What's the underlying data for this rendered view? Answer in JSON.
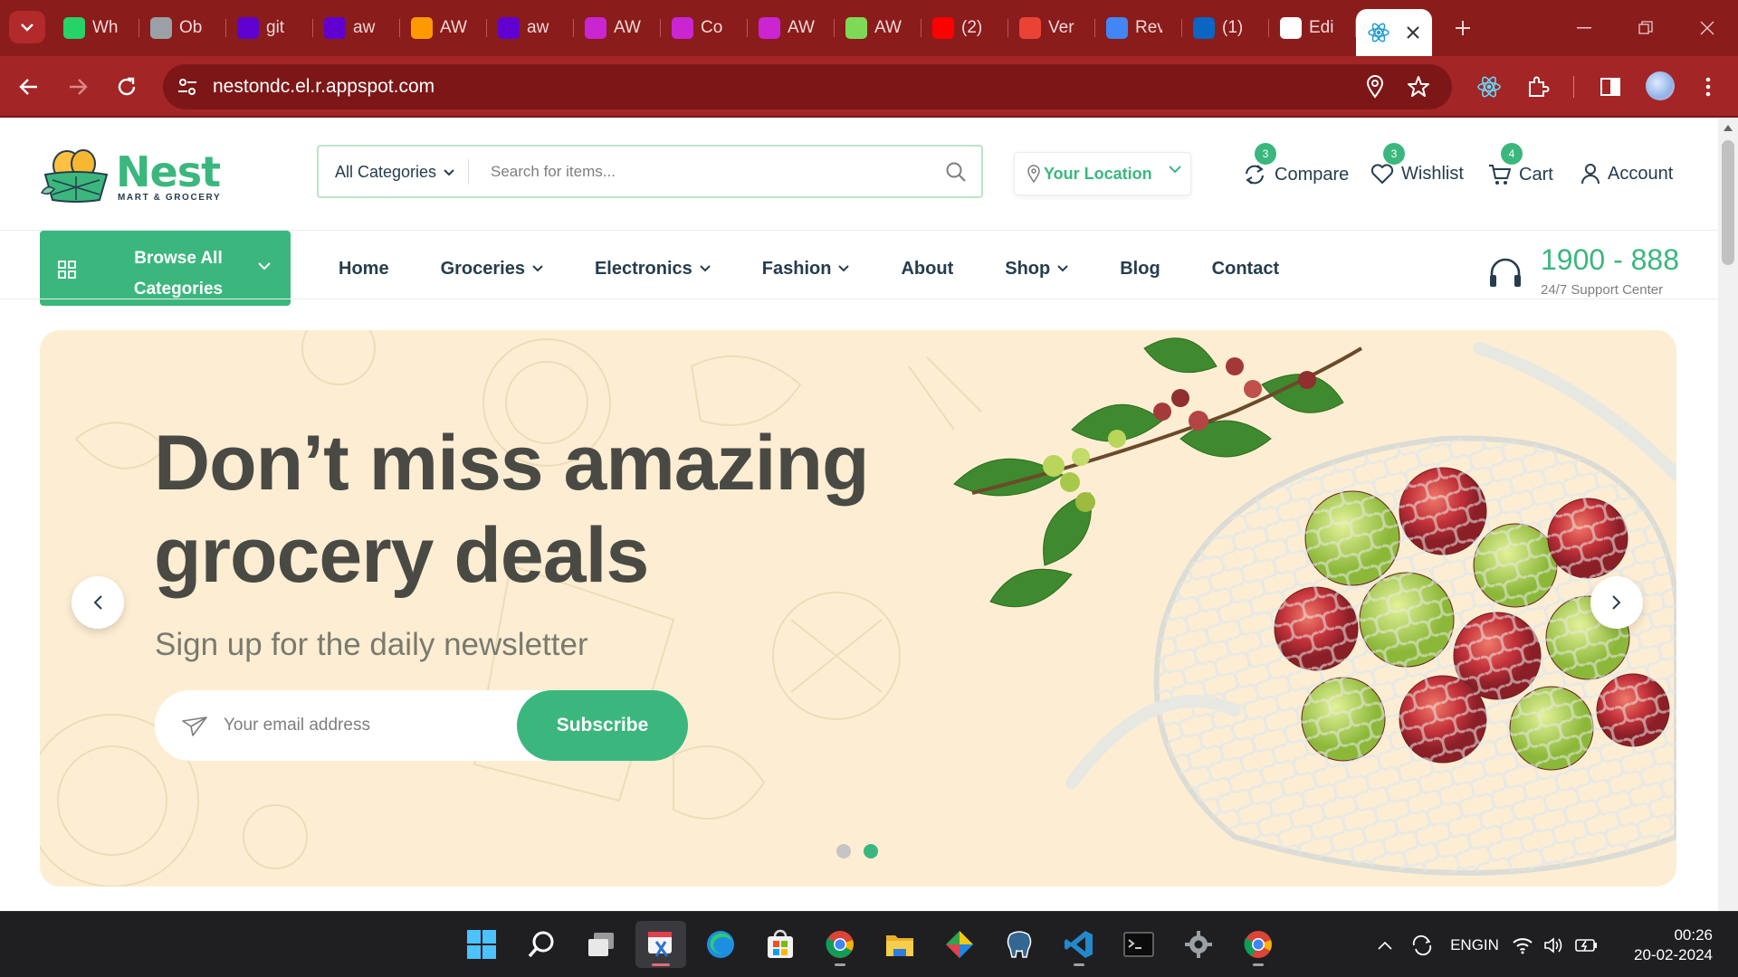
{
  "browser": {
    "tabs": [
      {
        "label": "Wh",
        "icon": "whatsapp-icon",
        "color": "#25d366"
      },
      {
        "label": "Ob",
        "icon": "globe-icon",
        "color": "#9aa0a6"
      },
      {
        "label": "git",
        "icon": "yahoo-icon",
        "color": "#6001d2"
      },
      {
        "label": "aw",
        "icon": "yahoo-icon",
        "color": "#6001d2"
      },
      {
        "label": "AW",
        "icon": "aws-box-icon",
        "color": "#ff9900"
      },
      {
        "label": "aw",
        "icon": "yahoo-icon",
        "color": "#6001d2"
      },
      {
        "label": "AW",
        "icon": "aws-cube-icon",
        "color": "#c925d1"
      },
      {
        "label": "Co",
        "icon": "aws-cube-icon",
        "color": "#c925d1"
      },
      {
        "label": "AW",
        "icon": "aws-cube-icon",
        "color": "#c925d1"
      },
      {
        "label": "AW",
        "icon": "pulse-icon",
        "color": "#7ed957"
      },
      {
        "label": "(2)",
        "icon": "youtube-icon",
        "color": "#ff0000"
      },
      {
        "label": "Ver",
        "icon": "gmail-icon",
        "color": "#ea4335"
      },
      {
        "label": "Rev",
        "icon": "google-icon",
        "color": "#4285f4"
      },
      {
        "label": "(1)",
        "icon": "linkedin-icon",
        "color": "#0a66c2"
      },
      {
        "label": "Edi",
        "icon": "github-icon",
        "color": "#ffffff"
      }
    ],
    "active_tab_icon": "react-icon",
    "url": "nestondc.el.r.appspot.com"
  },
  "header": {
    "logo_name": "Nest",
    "logo_tagline": "MART & GROCERY",
    "category_select": "All Categories",
    "search_placeholder": "Search for items...",
    "location_label": "Your Location",
    "actions": [
      {
        "label": "Compare",
        "badge": "3"
      },
      {
        "label": "Wishlist",
        "badge": "3"
      },
      {
        "label": "Cart",
        "badge": "4"
      },
      {
        "label": "Account"
      }
    ]
  },
  "nav": {
    "browse_label": "Browse All Categories",
    "items": [
      {
        "label": "Home",
        "dropdown": false
      },
      {
        "label": "Groceries",
        "dropdown": true
      },
      {
        "label": "Electronics",
        "dropdown": true
      },
      {
        "label": "Fashion",
        "dropdown": true
      },
      {
        "label": "About",
        "dropdown": false
      },
      {
        "label": "Shop",
        "dropdown": true
      },
      {
        "label": "Blog",
        "dropdown": false
      },
      {
        "label": "Contact",
        "dropdown": false
      }
    ],
    "support_phone": "1900 - 888",
    "support_text": "24/7 Support Center"
  },
  "hero": {
    "title": "Don’t miss amazing grocery deals",
    "subtitle": "Sign up for the daily newsletter",
    "email_placeholder": "Your email address",
    "subscribe_label": "Subscribe",
    "active_slide": 2,
    "slide_count": 2
  },
  "taskbar": {
    "lang": "ENG",
    "region": "IN",
    "time": "00:26",
    "date": "20-02-2024"
  },
  "colors": {
    "brand": "#3bb77e",
    "chrome": "#a32525",
    "hero_bg": "#fdeed3",
    "heading": "#253d4e"
  }
}
